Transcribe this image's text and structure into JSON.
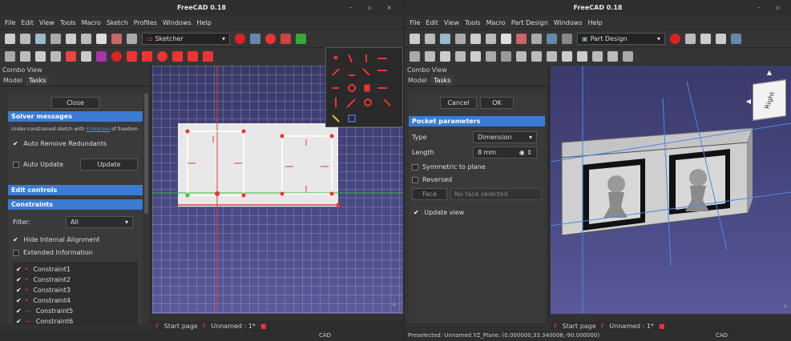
{
  "window1": {
    "title": "FreeCAD 0.18",
    "menu": [
      "File",
      "Edit",
      "View",
      "Tools",
      "Macro",
      "Sketch",
      "Profiles",
      "Windows",
      "Help"
    ],
    "workbench": "Sketcher",
    "combo_view_title": "Combo View",
    "tabs": {
      "model": "Model",
      "tasks": "Tasks"
    },
    "close_label": "Close",
    "solver": {
      "header": "Solver messages",
      "message_prefix": "Under-constrained sketch with",
      "message_link": "8 degrees",
      "message_suffix": "of freedom",
      "auto_remove": "Auto Remove Redundants",
      "auto_update": "Auto Update",
      "update_button": "Update"
    },
    "edit_controls": "Edit controls",
    "constraints": {
      "header": "Constraints",
      "filter_label": "Filter:",
      "filter_value": "All",
      "hide_internal": "Hide Internal Alignment",
      "extended_info": "Extended Information",
      "items": [
        "Constraint1",
        "Constraint2",
        "Constraint3",
        "Constraint4",
        "Constraint5",
        "Constraint6"
      ]
    },
    "doc_tabs": {
      "start": "Start page",
      "unnamed": "Unnamed : 1*"
    },
    "status": "CAD"
  },
  "window2": {
    "title": "FreeCAD 0.18",
    "menu": [
      "File",
      "Edit",
      "View",
      "Tools",
      "Macro",
      "Part Design",
      "Windows",
      "Help"
    ],
    "workbench": "Part Design",
    "combo_view_title": "Combo View",
    "tabs": {
      "model": "Model",
      "tasks": "Tasks"
    },
    "cancel_label": "Cancel",
    "ok_label": "OK",
    "pocket": {
      "header": "Pocket parameters",
      "type_label": "Type",
      "type_value": "Dimension",
      "length_label": "Length",
      "length_value": "8 mm",
      "symmetric": "Symmetric to plane",
      "reversed": "Reversed",
      "face_button": "Face",
      "face_placeholder": "No face selected",
      "update_view": "Update view"
    },
    "navcube_label": "Right",
    "doc_tabs": {
      "start": "Start page",
      "unnamed": "Unnamed : 1*"
    },
    "status": "Preselected: Unnamed.YZ_Plane. (0.000000,33.340008,-90.000000)",
    "status_right": "CAD"
  },
  "colors": {
    "accent": "#3b7bd3",
    "constraint_red": "#e0302a",
    "bg": "#323232"
  }
}
